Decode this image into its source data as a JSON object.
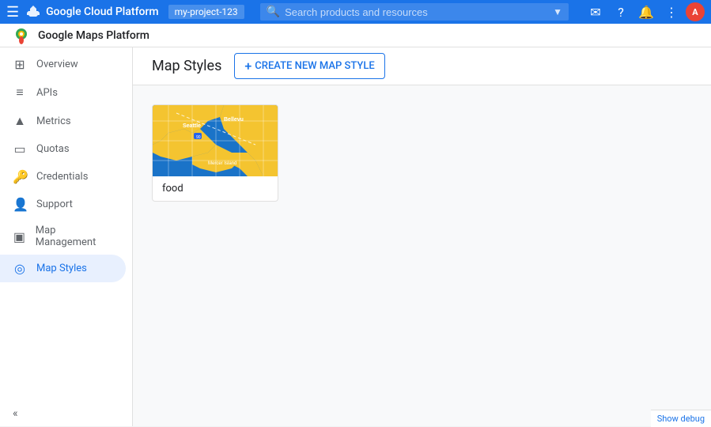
{
  "topbar": {
    "title": "Google Cloud Platform",
    "account_label": "my-project-123",
    "search_placeholder": "Search products and resources",
    "menu_icon": "☰",
    "email_icon": "✉",
    "help_icon": "?",
    "notification_icon": "🔔",
    "more_icon": "⋮",
    "avatar_text": "A"
  },
  "product_bar": {
    "title": "Google Maps Platform"
  },
  "sidebar": {
    "items": [
      {
        "label": "Overview",
        "icon": "⊞",
        "active": false
      },
      {
        "label": "APIs",
        "icon": "≡",
        "active": false
      },
      {
        "label": "Metrics",
        "icon": "↑",
        "active": false
      },
      {
        "label": "Quotas",
        "icon": "▭",
        "active": false
      },
      {
        "label": "Credentials",
        "icon": "🔑",
        "active": false
      },
      {
        "label": "Support",
        "icon": "👤",
        "active": false
      },
      {
        "label": "Map Management",
        "icon": "▣",
        "active": false
      },
      {
        "label": "Map Styles",
        "icon": "◎",
        "active": true
      }
    ],
    "collapse_label": "Collapse"
  },
  "content": {
    "title": "Map Styles",
    "create_button_label": "CREATE NEW MAP STYLE",
    "map_card": {
      "name": "food"
    }
  },
  "footer": {
    "debug_label": "Show debug"
  }
}
